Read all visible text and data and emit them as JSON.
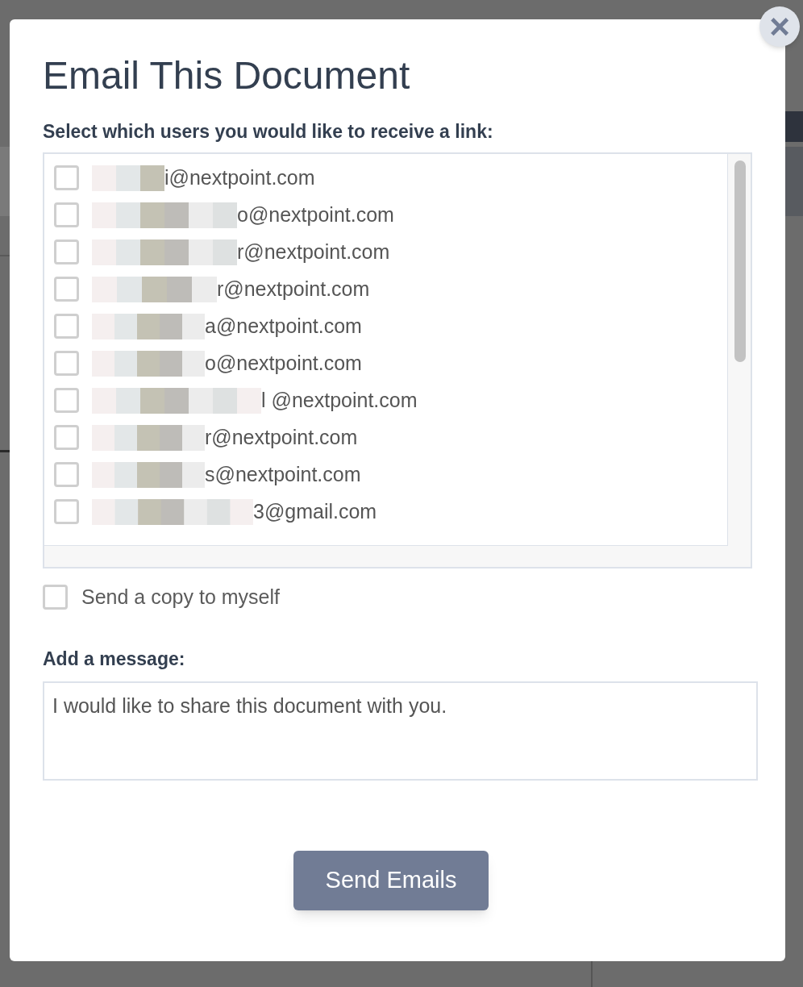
{
  "dialog": {
    "title": "Email This Document",
    "close": "×"
  },
  "users_label": "Select which users you would like to receive a link:",
  "users": [
    {
      "email": "i@nextpoint.com",
      "checked": false
    },
    {
      "email": "o@nextpoint.com",
      "checked": false
    },
    {
      "email": "r@nextpoint.com",
      "checked": false
    },
    {
      "email": "r@nextpoint.com",
      "checked": false
    },
    {
      "email": "a@nextpoint.com",
      "checked": false
    },
    {
      "email": "o@nextpoint.com",
      "checked": false
    },
    {
      "email": "l @nextpoint.com",
      "checked": false
    },
    {
      "email": "r@nextpoint.com",
      "checked": false
    },
    {
      "email": "s@nextpoint.com",
      "checked": false
    },
    {
      "email": "3@gmail.com",
      "checked": false
    }
  ],
  "copy_to_self": {
    "label": "Send a copy to myself",
    "checked": false
  },
  "message_label": "Add a message:",
  "message": {
    "value": "I would like to share this document with you."
  },
  "send_button": "Send Emails"
}
